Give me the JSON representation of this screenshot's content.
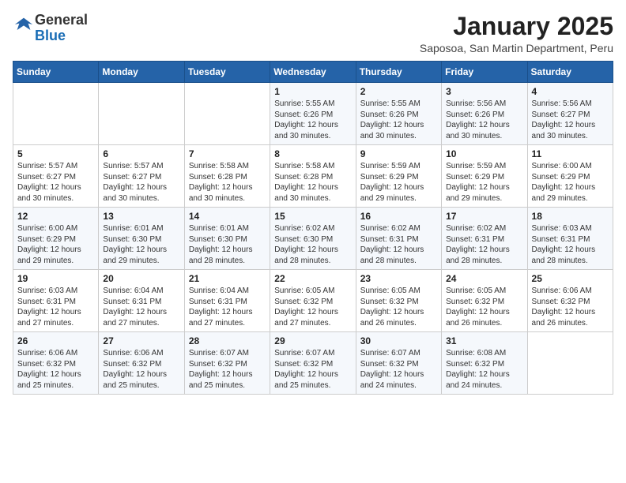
{
  "logo": {
    "text_general": "General",
    "text_blue": "Blue"
  },
  "header": {
    "month_year": "January 2025",
    "location": "Saposoa, San Martin Department, Peru"
  },
  "days_of_week": [
    "Sunday",
    "Monday",
    "Tuesday",
    "Wednesday",
    "Thursday",
    "Friday",
    "Saturday"
  ],
  "weeks": [
    [
      {
        "day": "",
        "info": ""
      },
      {
        "day": "",
        "info": ""
      },
      {
        "day": "",
        "info": ""
      },
      {
        "day": "1",
        "info": "Sunrise: 5:55 AM\nSunset: 6:26 PM\nDaylight: 12 hours\nand 30 minutes."
      },
      {
        "day": "2",
        "info": "Sunrise: 5:55 AM\nSunset: 6:26 PM\nDaylight: 12 hours\nand 30 minutes."
      },
      {
        "day": "3",
        "info": "Sunrise: 5:56 AM\nSunset: 6:26 PM\nDaylight: 12 hours\nand 30 minutes."
      },
      {
        "day": "4",
        "info": "Sunrise: 5:56 AM\nSunset: 6:27 PM\nDaylight: 12 hours\nand 30 minutes."
      }
    ],
    [
      {
        "day": "5",
        "info": "Sunrise: 5:57 AM\nSunset: 6:27 PM\nDaylight: 12 hours\nand 30 minutes."
      },
      {
        "day": "6",
        "info": "Sunrise: 5:57 AM\nSunset: 6:27 PM\nDaylight: 12 hours\nand 30 minutes."
      },
      {
        "day": "7",
        "info": "Sunrise: 5:58 AM\nSunset: 6:28 PM\nDaylight: 12 hours\nand 30 minutes."
      },
      {
        "day": "8",
        "info": "Sunrise: 5:58 AM\nSunset: 6:28 PM\nDaylight: 12 hours\nand 30 minutes."
      },
      {
        "day": "9",
        "info": "Sunrise: 5:59 AM\nSunset: 6:29 PM\nDaylight: 12 hours\nand 29 minutes."
      },
      {
        "day": "10",
        "info": "Sunrise: 5:59 AM\nSunset: 6:29 PM\nDaylight: 12 hours\nand 29 minutes."
      },
      {
        "day": "11",
        "info": "Sunrise: 6:00 AM\nSunset: 6:29 PM\nDaylight: 12 hours\nand 29 minutes."
      }
    ],
    [
      {
        "day": "12",
        "info": "Sunrise: 6:00 AM\nSunset: 6:29 PM\nDaylight: 12 hours\nand 29 minutes."
      },
      {
        "day": "13",
        "info": "Sunrise: 6:01 AM\nSunset: 6:30 PM\nDaylight: 12 hours\nand 29 minutes."
      },
      {
        "day": "14",
        "info": "Sunrise: 6:01 AM\nSunset: 6:30 PM\nDaylight: 12 hours\nand 28 minutes."
      },
      {
        "day": "15",
        "info": "Sunrise: 6:02 AM\nSunset: 6:30 PM\nDaylight: 12 hours\nand 28 minutes."
      },
      {
        "day": "16",
        "info": "Sunrise: 6:02 AM\nSunset: 6:31 PM\nDaylight: 12 hours\nand 28 minutes."
      },
      {
        "day": "17",
        "info": "Sunrise: 6:02 AM\nSunset: 6:31 PM\nDaylight: 12 hours\nand 28 minutes."
      },
      {
        "day": "18",
        "info": "Sunrise: 6:03 AM\nSunset: 6:31 PM\nDaylight: 12 hours\nand 28 minutes."
      }
    ],
    [
      {
        "day": "19",
        "info": "Sunrise: 6:03 AM\nSunset: 6:31 PM\nDaylight: 12 hours\nand 27 minutes."
      },
      {
        "day": "20",
        "info": "Sunrise: 6:04 AM\nSunset: 6:31 PM\nDaylight: 12 hours\nand 27 minutes."
      },
      {
        "day": "21",
        "info": "Sunrise: 6:04 AM\nSunset: 6:31 PM\nDaylight: 12 hours\nand 27 minutes."
      },
      {
        "day": "22",
        "info": "Sunrise: 6:05 AM\nSunset: 6:32 PM\nDaylight: 12 hours\nand 27 minutes."
      },
      {
        "day": "23",
        "info": "Sunrise: 6:05 AM\nSunset: 6:32 PM\nDaylight: 12 hours\nand 26 minutes."
      },
      {
        "day": "24",
        "info": "Sunrise: 6:05 AM\nSunset: 6:32 PM\nDaylight: 12 hours\nand 26 minutes."
      },
      {
        "day": "25",
        "info": "Sunrise: 6:06 AM\nSunset: 6:32 PM\nDaylight: 12 hours\nand 26 minutes."
      }
    ],
    [
      {
        "day": "26",
        "info": "Sunrise: 6:06 AM\nSunset: 6:32 PM\nDaylight: 12 hours\nand 25 minutes."
      },
      {
        "day": "27",
        "info": "Sunrise: 6:06 AM\nSunset: 6:32 PM\nDaylight: 12 hours\nand 25 minutes."
      },
      {
        "day": "28",
        "info": "Sunrise: 6:07 AM\nSunset: 6:32 PM\nDaylight: 12 hours\nand 25 minutes."
      },
      {
        "day": "29",
        "info": "Sunrise: 6:07 AM\nSunset: 6:32 PM\nDaylight: 12 hours\nand 25 minutes."
      },
      {
        "day": "30",
        "info": "Sunrise: 6:07 AM\nSunset: 6:32 PM\nDaylight: 12 hours\nand 24 minutes."
      },
      {
        "day": "31",
        "info": "Sunrise: 6:08 AM\nSunset: 6:32 PM\nDaylight: 12 hours\nand 24 minutes."
      },
      {
        "day": "",
        "info": ""
      }
    ]
  ]
}
